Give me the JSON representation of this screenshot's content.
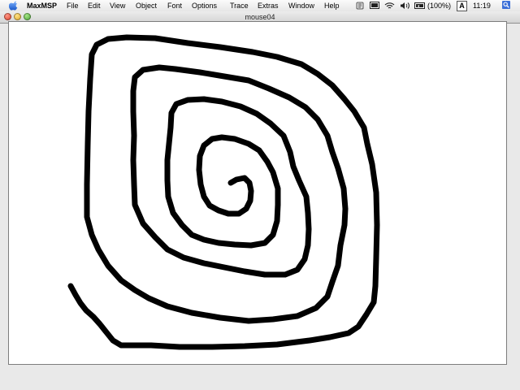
{
  "menubar": {
    "apple_icon": "apple-logo-icon",
    "app_name": "MaxMSP",
    "menus": [
      "File",
      "Edit",
      "View",
      "Object",
      "Font",
      "Options",
      "Trace",
      "Extras",
      "Window",
      "Help"
    ],
    "battery_text": "(100%)",
    "input_indicator": "A",
    "clock": "11:19",
    "status_icons": [
      "script-menu-icon",
      "screen-icon",
      "wifi-icon",
      "volume-icon",
      "battery-icon",
      "spotlight-icon"
    ]
  },
  "window": {
    "title": "mouse04",
    "buttons": [
      "close",
      "minimize",
      "zoom"
    ]
  },
  "colors": {
    "stroke": "#000000",
    "canvas_bg": "#ffffff",
    "menubar_bg": "#ececec"
  }
}
